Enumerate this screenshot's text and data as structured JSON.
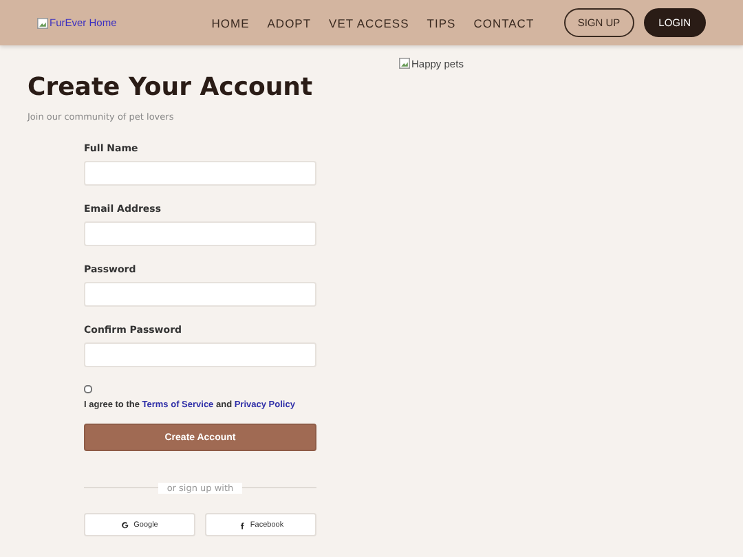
{
  "header": {
    "logo_alt": "FurEver Home",
    "nav": [
      {
        "label": "HOME"
      },
      {
        "label": "ADOPT"
      },
      {
        "label": "VET ACCESS"
      },
      {
        "label": "TIPS"
      },
      {
        "label": "CONTACT"
      }
    ],
    "buttons": [
      {
        "label": "SIGN UP",
        "kind": "outline"
      },
      {
        "label": "LOGIN",
        "kind": "solid"
      }
    ]
  },
  "hero_image_alt": "Happy pets",
  "title": "Create Your Account",
  "subtitle": "Join our community of pet lovers",
  "fields": [
    {
      "label": "Full Name"
    },
    {
      "label": "Email Address"
    },
    {
      "label": "Password"
    },
    {
      "label": "Confirm Password"
    }
  ],
  "agreement": {
    "checked": false,
    "parts": [
      {
        "kind": "text",
        "text": "I agree to the "
      },
      {
        "kind": "link",
        "text": "Terms of Service"
      },
      {
        "kind": "text",
        "text": " and "
      },
      {
        "kind": "link",
        "text": "Privacy Policy"
      }
    ]
  },
  "submit": "Create Account",
  "divider": "or sign up with",
  "social": [
    {
      "label": "Google",
      "kind": "google"
    },
    {
      "label": "Facebook",
      "kind": "facebook"
    }
  ]
}
